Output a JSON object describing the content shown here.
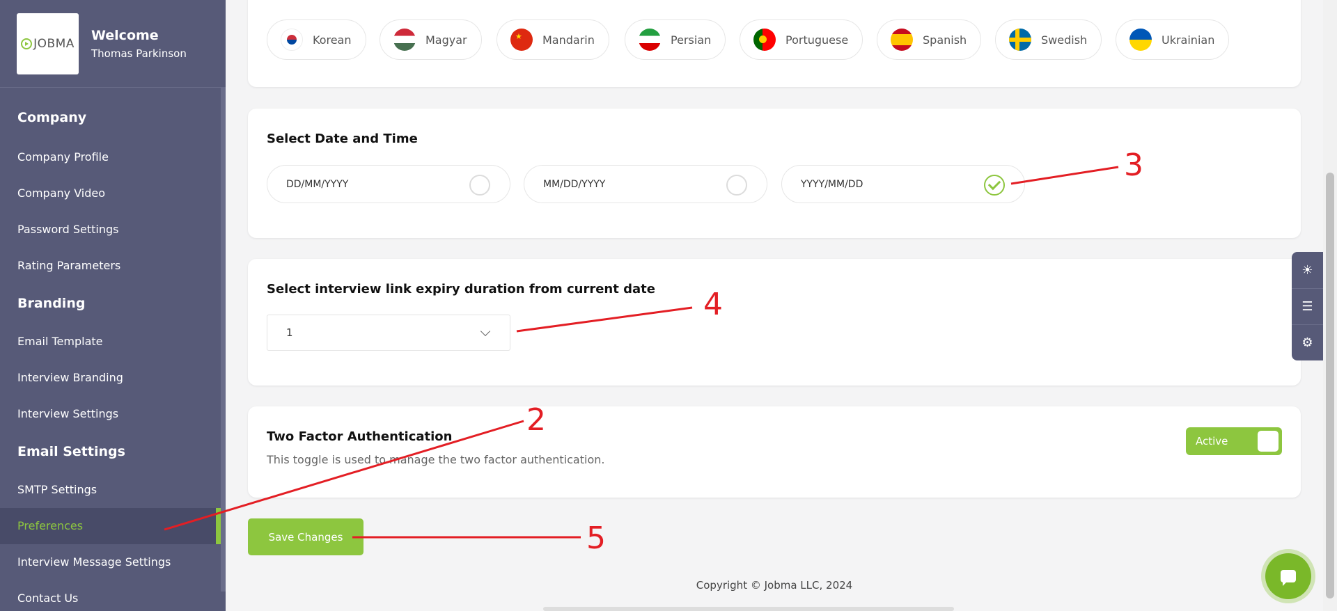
{
  "sidebar": {
    "logo_text": "JOBMA",
    "welcome": "Welcome",
    "user_name": "Thomas Parkinson",
    "sections": [
      {
        "title": "Company",
        "items": [
          "Company Profile",
          "Company Video",
          "Password Settings",
          "Rating Parameters"
        ]
      },
      {
        "title": "Branding",
        "items": [
          "Email Template",
          "Interview Branding",
          "Interview Settings"
        ]
      },
      {
        "title": "Email Settings",
        "items": [
          "SMTP Settings",
          "Preferences",
          "Interview Message Settings",
          "Contact Us"
        ]
      }
    ],
    "active_item": "Preferences"
  },
  "languages": [
    "Korean",
    "Magyar",
    "Mandarin",
    "Persian",
    "Portuguese",
    "Spanish",
    "Swedish",
    "Ukrainian"
  ],
  "date_time": {
    "title": "Select Date and Time",
    "options": [
      "DD/MM/YYYY",
      "MM/DD/YYYY",
      "YYYY/MM/DD"
    ],
    "selected": "YYYY/MM/DD"
  },
  "expiry": {
    "title": "Select interview link expiry duration from current date",
    "value": "1"
  },
  "two_factor": {
    "title": "Two Factor Authentication",
    "description": "This toggle is used to manage the two factor authentication.",
    "toggle_label": "Active"
  },
  "save_label": "Save Changes",
  "copyright": "Copyright © Jobma LLC, 2024",
  "annotations": [
    "2",
    "3",
    "4",
    "5"
  ],
  "colors": {
    "accent": "#8dc63f",
    "sidebar": "#575a78",
    "annotation": "#e31e24"
  }
}
